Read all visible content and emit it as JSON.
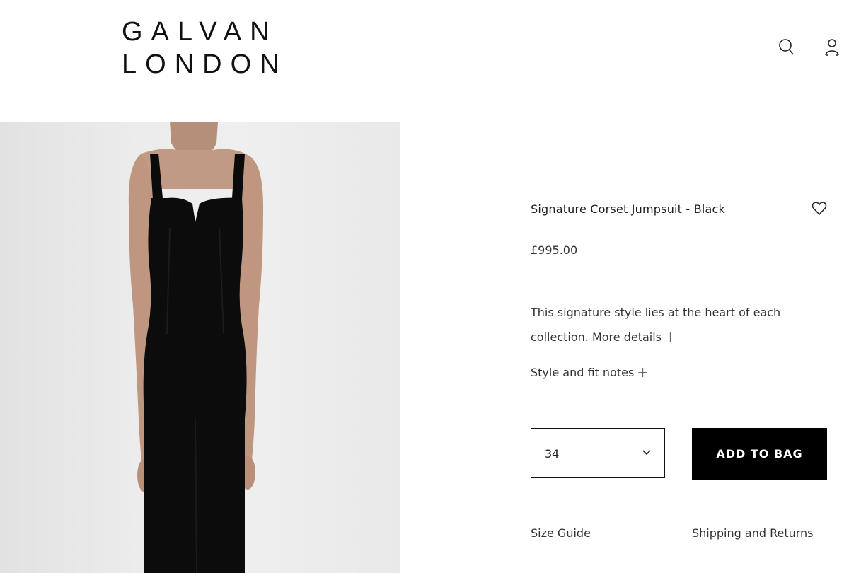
{
  "header": {
    "logo_line1": "GALVAN",
    "logo_line2": "LONDON",
    "search_icon": "search-icon",
    "account_icon": "user-icon"
  },
  "product": {
    "image_alt": "Model wearing black corset jumpsuit",
    "title": "Signature Corset Jumpsuit - Black",
    "price": "£995.00",
    "description": "This signature style lies at the heart of each collection.",
    "more_details": "More details",
    "style_fit_notes": "Style and fit notes",
    "selected_size": "34",
    "add_to_bag": "ADD TO BAG",
    "size_guide": "Size Guide",
    "shipping_returns": "Shipping and Returns"
  },
  "colors": {
    "accent": "#000000",
    "text": "#333333",
    "image_background": "#ebebeb"
  }
}
